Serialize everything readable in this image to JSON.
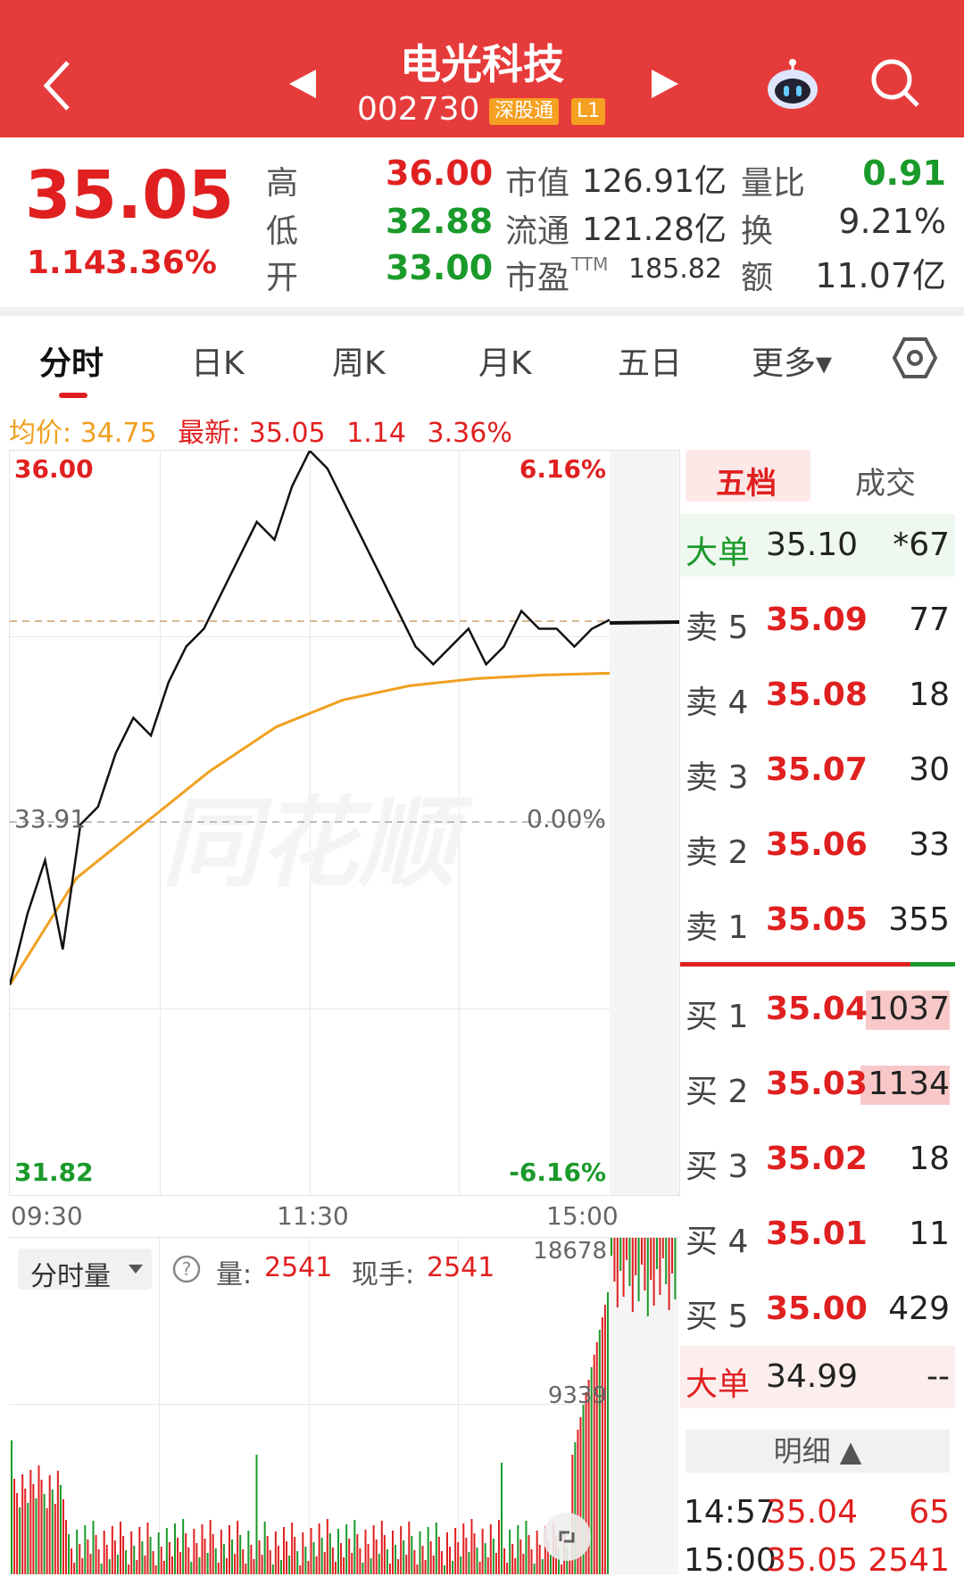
{
  "header": {
    "title": "电光科技",
    "code": "002730",
    "badge_market": "深股通",
    "badge_level": "L1"
  },
  "icons": {
    "back": "chevron-left-icon",
    "prev": "triangle-left-icon",
    "next": "triangle-right-icon",
    "assistant": "robot-icon",
    "search": "search-icon",
    "settings": "hexagon-settings-icon",
    "fullscreen": "expand-icon",
    "help": "question-icon"
  },
  "quote": {
    "price": "35.05",
    "change": "1.14",
    "change_pct": "3.36%",
    "high_label": "高",
    "high": "36.00",
    "low_label": "低",
    "low": "32.88",
    "open_label": "开",
    "open": "33.00",
    "mktcap_label": "市值",
    "mktcap": "126.91亿",
    "float_label": "流通",
    "float": "121.28亿",
    "pe_label": "市盈",
    "pe_sup": "TTM",
    "pe": "185.82",
    "vr_label": "量比",
    "vr": "0.91",
    "turnover_label": "换",
    "turnover": "9.21%",
    "amount_label": "额",
    "amount": "11.07亿"
  },
  "tabs": [
    "分时",
    "日K",
    "周K",
    "月K",
    "五日",
    "更多▾"
  ],
  "info": {
    "avg_label": "均价:",
    "avg": "34.75",
    "last_label": "最新:",
    "last": "35.05",
    "chg": "1.14",
    "chg_pct": "3.36%"
  },
  "chart": {
    "y_top": "36.00",
    "y_mid": "33.91",
    "y_bot": "31.82",
    "pct_top": "6.16%",
    "pct_mid": "0.00%",
    "pct_bot": "-6.16%",
    "times": [
      "09:30",
      "11:30",
      "15:00"
    ],
    "watermark": "同花顺",
    "colors": {
      "price": "#111111",
      "avg": "#f0a020",
      "up": "#e02020",
      "down": "#1a9a2a"
    }
  },
  "volume": {
    "selector": "分时量",
    "vol_label": "量:",
    "vol": "2541",
    "hand_label": "现手:",
    "hand": "2541",
    "max": "18678",
    "mid": "9339"
  },
  "orderbook": {
    "tab_active": "五档",
    "tab_other": "成交",
    "big_sell_label": "大单",
    "big_sell_price": "35.10",
    "big_sell_vol": "*67",
    "asks": [
      {
        "label": "卖 5",
        "price": "35.09",
        "vol": "77"
      },
      {
        "label": "卖 4",
        "price": "35.08",
        "vol": "18"
      },
      {
        "label": "卖 3",
        "price": "35.07",
        "vol": "30"
      },
      {
        "label": "卖 2",
        "price": "35.06",
        "vol": "33"
      },
      {
        "label": "卖 1",
        "price": "35.05",
        "vol": "355"
      }
    ],
    "bids": [
      {
        "label": "买 1",
        "price": "35.04",
        "vol": "1037"
      },
      {
        "label": "买 2",
        "price": "35.03",
        "vol": "1134"
      },
      {
        "label": "买 3",
        "price": "35.02",
        "vol": "18"
      },
      {
        "label": "买 4",
        "price": "35.01",
        "vol": "11"
      },
      {
        "label": "买 5",
        "price": "35.00",
        "vol": "429"
      }
    ],
    "big_buy_label": "大单",
    "big_buy_price": "34.99",
    "big_buy_vol": "--",
    "detail_label": "明细 ▲",
    "trades": [
      {
        "time": "14:57",
        "price": "35.04",
        "vol": "65"
      },
      {
        "time": "15:00",
        "price": "35.05",
        "vol": "2541"
      }
    ]
  }
}
